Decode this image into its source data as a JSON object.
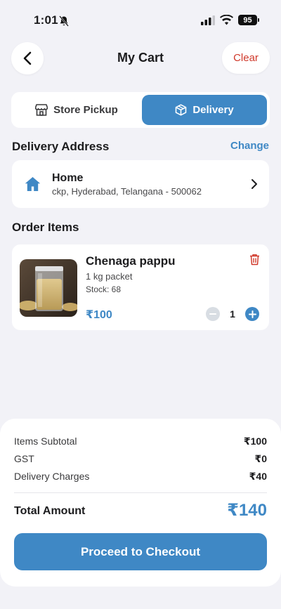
{
  "status_bar": {
    "time": "1:01",
    "battery": "95"
  },
  "header": {
    "title": "My Cart",
    "clear_label": "Clear"
  },
  "mode_toggle": {
    "pickup_label": "Store Pickup",
    "delivery_label": "Delivery",
    "selected": "Delivery"
  },
  "delivery_address": {
    "section_title": "Delivery Address",
    "change_label": "Change",
    "label": "Home",
    "address": "ckp, Hyderabad, Telangana - 500062"
  },
  "order_items": {
    "section_title": "Order Items",
    "items": [
      {
        "name": "Chenaga pappu",
        "variant": "1 kg packet",
        "stock": "Stock: 68",
        "price": "₹100",
        "quantity": "1"
      }
    ]
  },
  "summary": {
    "rows": [
      {
        "label": "Items Subtotal",
        "value": "₹100"
      },
      {
        "label": "GST",
        "value": "₹0"
      },
      {
        "label": "Delivery Charges",
        "value": "₹40"
      }
    ],
    "total_label": "Total Amount",
    "total_value": "₹140",
    "checkout_label": "Proceed to Checkout"
  },
  "colors": {
    "accent": "#3f88c5",
    "danger": "#d0392b",
    "background": "#f2f2f7"
  },
  "icons": [
    "bell-off-icon",
    "signal-icon",
    "wifi-icon",
    "battery-icon",
    "back-arrow-icon",
    "store-icon",
    "box-icon",
    "home-icon",
    "chevron-right-icon",
    "trash-icon",
    "minus-icon",
    "plus-icon"
  ]
}
